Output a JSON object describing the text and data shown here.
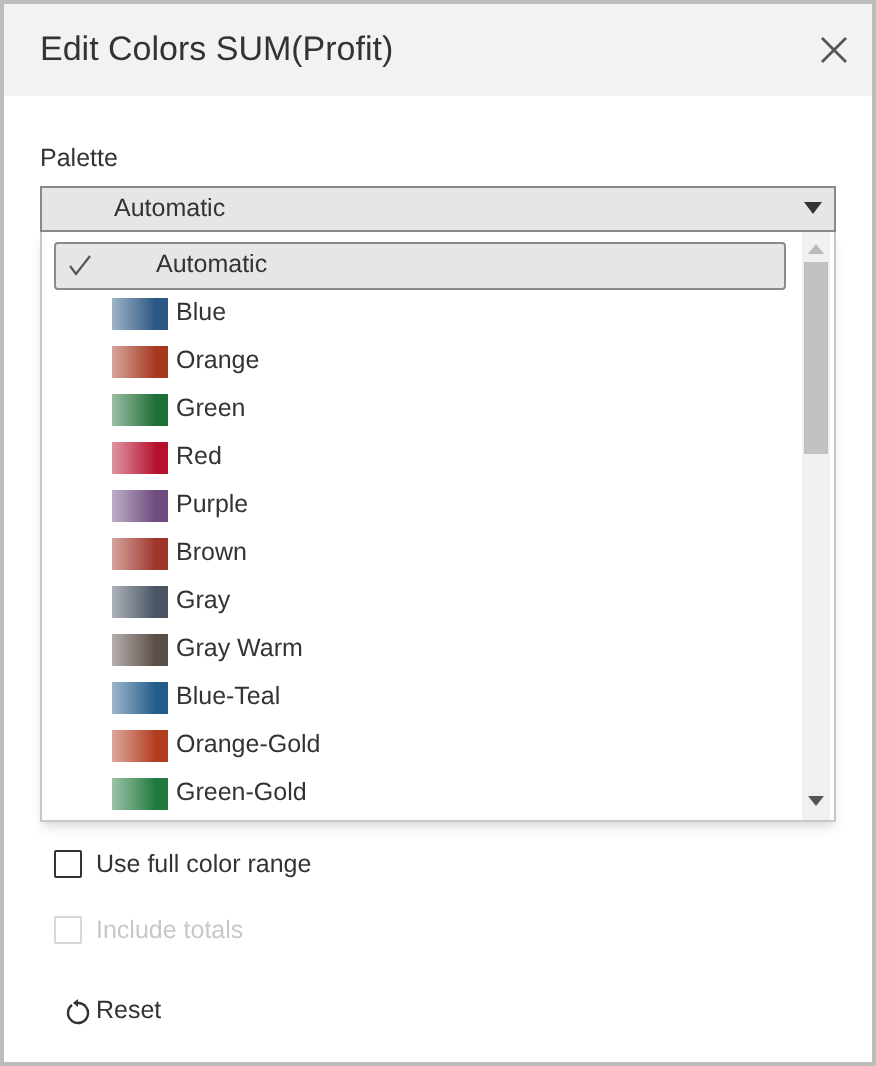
{
  "window": {
    "title": "Edit Colors SUM(Profit)"
  },
  "palette": {
    "label": "Palette",
    "value": "Automatic",
    "expanded": true,
    "options": [
      {
        "label": "Automatic",
        "selected": true,
        "kind": "plain"
      },
      {
        "label": "Blue",
        "selected": false,
        "kind": "gradient",
        "color": "#2a5783"
      },
      {
        "label": "Orange",
        "selected": false,
        "kind": "gradient",
        "color": "#a6381e"
      },
      {
        "label": "Green",
        "selected": false,
        "kind": "gradient",
        "color": "#1d6f36"
      },
      {
        "label": "Red",
        "selected": false,
        "kind": "gradient",
        "color": "#b6102f"
      },
      {
        "label": "Purple",
        "selected": false,
        "kind": "gradient",
        "color": "#6e4b80"
      },
      {
        "label": "Brown",
        "selected": false,
        "kind": "gradient",
        "color": "#a0352a"
      },
      {
        "label": "Gray",
        "selected": false,
        "kind": "gradient",
        "color": "#4a5563"
      },
      {
        "label": "Gray Warm",
        "selected": false,
        "kind": "gradient",
        "color": "#5b4e48"
      },
      {
        "label": "Blue-Teal",
        "selected": false,
        "kind": "gradient",
        "color": "#235c8b"
      },
      {
        "label": "Orange-Gold",
        "selected": false,
        "kind": "gradient",
        "color": "#b33c1f"
      },
      {
        "label": "Green-Gold",
        "selected": false,
        "kind": "gradient",
        "color": "#207a3e"
      }
    ]
  },
  "options": [
    {
      "label": "Use full color range",
      "checked": false,
      "disabled": false
    },
    {
      "label": "Include totals",
      "checked": false,
      "disabled": true
    }
  ],
  "reset_button": {
    "label": "Reset"
  }
}
